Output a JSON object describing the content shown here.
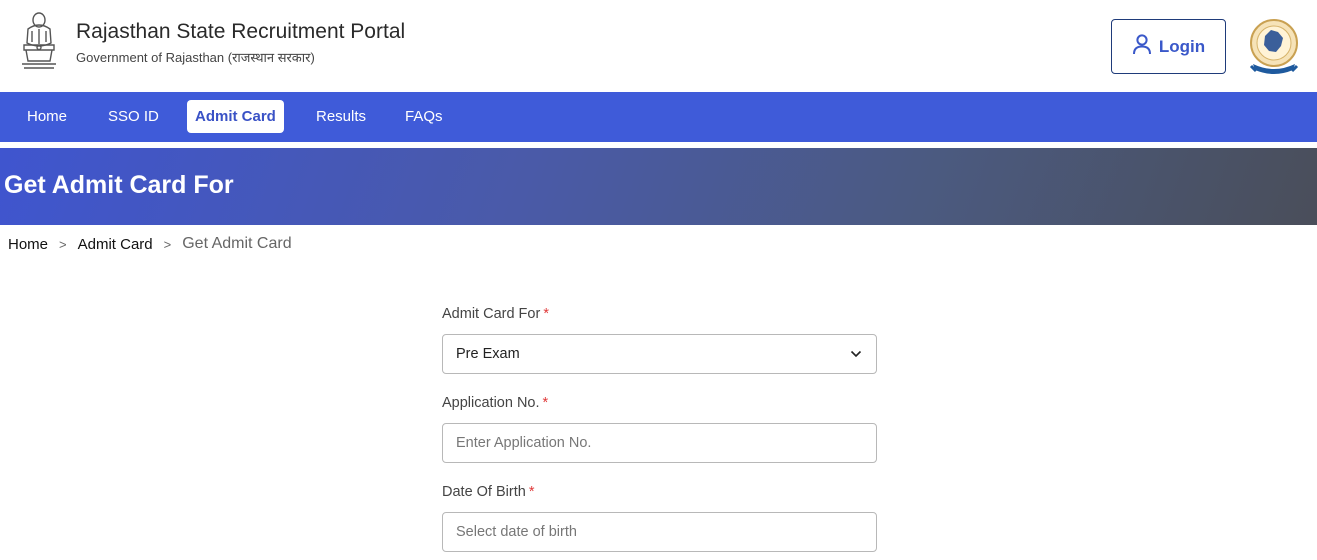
{
  "header": {
    "title": "Rajasthan State Recruitment Portal",
    "subtitle": "Government of Rajasthan (राजस्थान सरकार)",
    "login_label": "Login",
    "emblem_icon": "national-emblem-icon",
    "logo_icon": "rajasthan-map-logo-icon"
  },
  "nav": {
    "items": [
      {
        "label": "Home",
        "active": false
      },
      {
        "label": "SSO ID",
        "active": false
      },
      {
        "label": "Admit Card",
        "active": true
      },
      {
        "label": "Results",
        "active": false
      },
      {
        "label": "FAQs",
        "active": false
      }
    ]
  },
  "banner": {
    "title": "Get Admit Card For"
  },
  "breadcrumb": {
    "items": [
      "Home",
      "Admit Card",
      "Get Admit Card"
    ],
    "separator": ">"
  },
  "form": {
    "admit_card_for": {
      "label": "Admit Card For",
      "required_mark": "*",
      "value": "Pre Exam"
    },
    "application_no": {
      "label": "Application No.",
      "required_mark": "*",
      "placeholder": "Enter Application No.",
      "value": ""
    },
    "date_of_birth": {
      "label": "Date Of Birth",
      "required_mark": "*",
      "placeholder": "Select date of birth",
      "value": ""
    }
  },
  "colors": {
    "nav_background": "#3f5bd9",
    "accent": "#3a52c6",
    "required": "#e03a3a"
  }
}
